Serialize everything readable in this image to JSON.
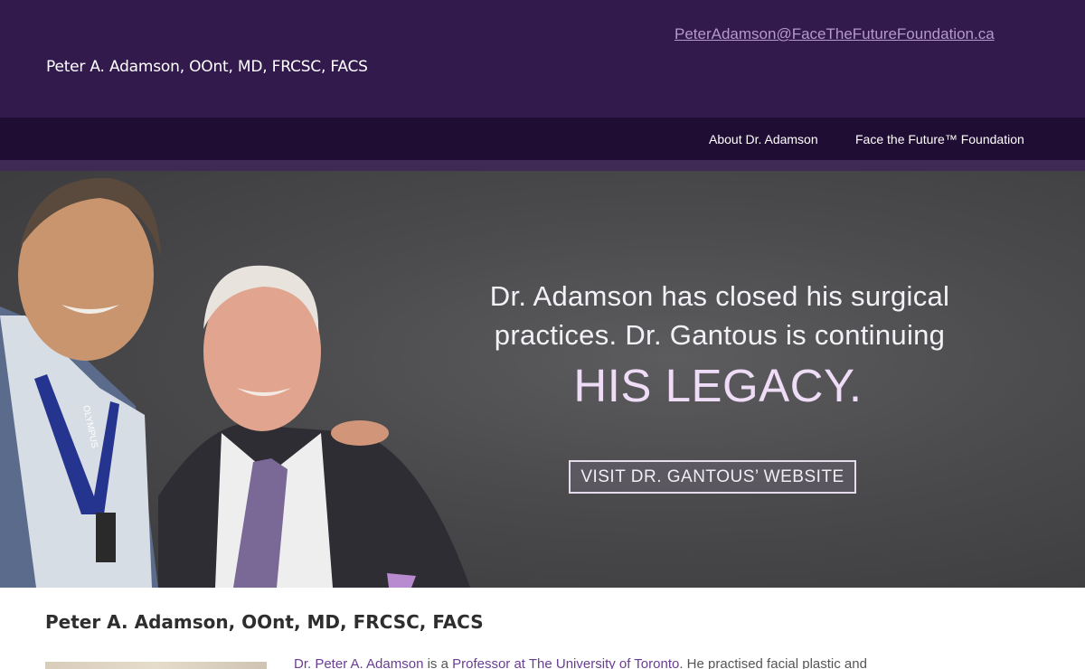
{
  "header": {
    "email": "PeterAdamson@FaceTheFutureFoundation.ca",
    "site_title": "Peter A. Adamson, OOnt, MD, FRCSC, FACS"
  },
  "nav": {
    "items": [
      {
        "label": "About Dr. Adamson"
      },
      {
        "label": "Face the Future™ Foundation"
      }
    ]
  },
  "hero": {
    "line1": "Dr. Adamson has closed his surgical",
    "line2": "practices. Dr. Gantous is continuing",
    "line3": "HIS LEGACY.",
    "button_label": "VISIT DR. GANTOUS’ WEBSITE",
    "lanyard_text": "OLYMPUS"
  },
  "content": {
    "heading": "Peter A. Adamson, OOnt, MD, FRCSC, FACS",
    "intro_link_1": "Dr. Peter A. Adamson",
    "intro_text_1": " is a ",
    "intro_link_2": "Professor at The University of Toronto",
    "intro_text_2": ". He practised facial plastic and"
  },
  "colors": {
    "header_bg": "#331a4d",
    "nav_bg": "#200d33",
    "accent_link": "#6a3d94",
    "email_link": "#b49acb"
  }
}
